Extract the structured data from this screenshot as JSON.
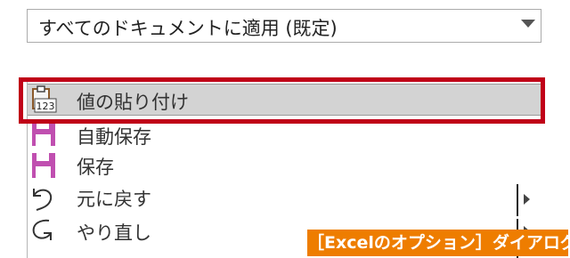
{
  "dropdown": {
    "value": "すべてのドキュメントに適用 (既定)"
  },
  "list": {
    "items": [
      {
        "label": "値の貼り付け",
        "icon": "paste-values-icon",
        "selected": true
      },
      {
        "label": "自動保存",
        "icon": "autosave-icon",
        "selected": false
      },
      {
        "label": "保存",
        "icon": "save-icon",
        "selected": false
      },
      {
        "label": "元に戻す",
        "icon": "undo-icon",
        "selected": false,
        "has_submenu": true
      },
      {
        "label": "やり直し",
        "icon": "redo-icon",
        "selected": false,
        "has_submenu": true
      }
    ]
  },
  "paste_icon_text": "123",
  "caption": "［Excelのオプション］ダイアログ",
  "colors": {
    "highlight": "#c00018",
    "caption_bg": "#ee7d00",
    "save_icon": "#c04fb0"
  }
}
